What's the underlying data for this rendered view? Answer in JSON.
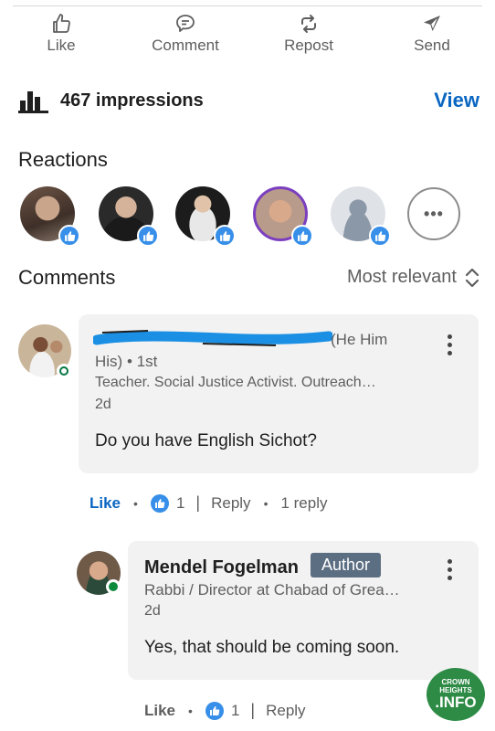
{
  "actions": {
    "like": "Like",
    "comment": "Comment",
    "repost": "Repost",
    "send": "Send"
  },
  "analytics": {
    "impressions": "467 impressions",
    "view": "View"
  },
  "reactions": {
    "title": "Reactions",
    "more": "•••"
  },
  "comments": {
    "title": "Comments",
    "sort": "Most relevant",
    "items": [
      {
        "pronouns_a": "(He Him",
        "pronouns_b": "His) • 1st",
        "headline": "Teacher. Social Justice Activist. Outreach…",
        "time": "2d",
        "text": "Do you have English Sichot?",
        "like": "Like",
        "like_count": "1",
        "reply": "Reply",
        "replies": "1 reply"
      },
      {
        "name": "Mendel Fogelman",
        "badge": "Author",
        "headline": "Rabbi / Director at Chabad of Grea…",
        "time": "2d",
        "text": "Yes, that should be coming soon.",
        "like": "Like",
        "like_count": "1",
        "reply": "Reply"
      }
    ]
  },
  "watermark": {
    "line1": "CROWN",
    "line2": "HEIGHTS",
    "line3": ".INFO"
  },
  "colors": {
    "accent": "#0a66c2",
    "reaction_blue": "#378fe9",
    "author_badge": "#5c6e82",
    "online_green": "#057642",
    "bubble": "#f2f2f2"
  }
}
